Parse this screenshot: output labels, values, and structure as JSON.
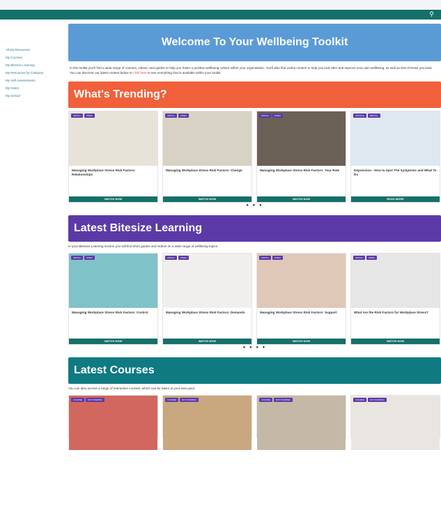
{
  "sidebar": {
    "items": [
      "All My Resources",
      "My Courses",
      "My Bitesize Learning",
      "My Resources by Category",
      "My Self Assessments",
      "My Notes",
      "My School"
    ]
  },
  "header": {
    "title": "Welcome To Your Wellbeing Toolkit"
  },
  "intro": {
    "text": "In this toolkit you'll find a wide range of courses, videos, and guides to help you foster a positive wellbeing culture within your organisation. You'll also find useful content to help you look after and improve your own wellbeing, as well as that of those you lead. You can discover our latest content below or",
    "link": "click here",
    "tail": "to see everything that is available within your toolkit."
  },
  "trending": {
    "title": "What's Trending?",
    "cards": [
      {
        "title": "Managing Workplace Stress Risk Factors: Relationships",
        "tags": [
          "WATCH",
          "VIDEO"
        ],
        "button": "WATCH NOW",
        "color": "#e8e3d9"
      },
      {
        "title": "Managing Workplace Stress Risk Factors: Change",
        "tags": [
          "WATCH",
          "VIDEO"
        ],
        "button": "WATCH NOW",
        "color": "#d8d2c4"
      },
      {
        "title": "Managing Workplace Stress Risk Factors: Your Role",
        "tags": [
          "WATCH",
          "VIDEO"
        ],
        "button": "WATCH NOW",
        "color": "#6b6157"
      },
      {
        "title": "Depression - How to Spot The Symptoms and What To Do",
        "tags": [
          "ARTICLE",
          "MENTAL"
        ],
        "button": "READ MORE",
        "color": "#dfe8f0"
      }
    ]
  },
  "bitesize": {
    "title": "Latest Bitesize Learning",
    "subtitle": "In your Bitesize Learning section you will find short guides and videos on a wide range of wellbeing topics.",
    "cards": [
      {
        "title": "Managing Workplace Stress Risk Factors: Control",
        "tags": [
          "WATCH",
          "VIDEO"
        ],
        "button": "WATCH NOW",
        "color": "#7fc2c8"
      },
      {
        "title": "Managing Workplace Stress Risk Factors: Demands",
        "tags": [
          "WATCH",
          "VIDEO"
        ],
        "button": "WATCH NOW",
        "color": "#f1efee"
      },
      {
        "title": "Managing Workplace Stress Risk Factors: Support",
        "tags": [
          "WATCH",
          "VIDEO"
        ],
        "button": "WATCH NOW",
        "color": "#e0c8b8"
      },
      {
        "title": "What Are the Risk Factors for Workplace Stress?",
        "tags": [
          "WATCH",
          "VIDEO"
        ],
        "button": "WATCH NOW",
        "color": "#e6e6e6"
      }
    ]
  },
  "courses": {
    "title": "Latest Courses",
    "subtitle": "You can also access a range of interactive courses, which can be taken at your own pace.",
    "cards": [
      {
        "tags": [
          "COURSE",
          "NOT STARTED"
        ],
        "color": "#d1675e"
      },
      {
        "tags": [
          "COURSE",
          "NOT STARTED"
        ],
        "color": "#c9a77f"
      },
      {
        "tags": [
          "COURSE",
          "NOT STARTED"
        ],
        "color": "#c4b9a7"
      },
      {
        "tags": [
          "COURSE",
          "NOT STARTED"
        ],
        "color": "#e9e6e1"
      }
    ]
  }
}
